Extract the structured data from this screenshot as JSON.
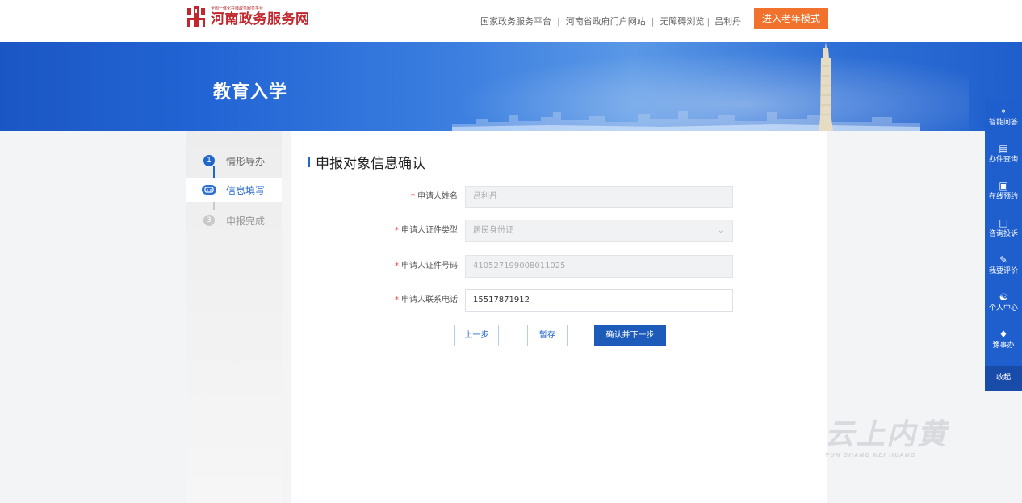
{
  "header": {
    "logo_tagline": "全国一体化在线政务服务平台",
    "logo_title": "河南政务服务网",
    "nav": [
      "国家政务服务平台",
      "河南省政府门户网站",
      "无障碍浏览",
      "吕利丹"
    ],
    "elder_mode": "进入老年模式"
  },
  "banner": {
    "title": "教育入学"
  },
  "steps": [
    {
      "num": "1",
      "label": "情形导办"
    },
    {
      "num": "",
      "label": "信息填写"
    },
    {
      "num": "3",
      "label": "申报完成"
    }
  ],
  "form": {
    "title": "申报对象信息确认",
    "fields": [
      {
        "label": "申请人姓名",
        "value": "吕利丹"
      },
      {
        "label": "申请人证件类型",
        "value": "居民身份证"
      },
      {
        "label": "申请人证件号码",
        "value": "410527199008011025"
      },
      {
        "label": "申请人联系电话",
        "value": "15517871912"
      }
    ],
    "required_mark": "*",
    "buttons": {
      "prev": "上一步",
      "save": "暂存",
      "next": "确认并下一步"
    }
  },
  "sidebar": {
    "items": [
      {
        "icon": "smart-qa-icon",
        "label": "智能问答"
      },
      {
        "icon": "search-doc-icon",
        "label": "办件查询"
      },
      {
        "icon": "calendar-icon",
        "label": "在线预约"
      },
      {
        "icon": "chat-icon",
        "label": "咨询投诉"
      },
      {
        "icon": "edit-icon",
        "label": "我要评价"
      },
      {
        "icon": "user-icon",
        "label": "个人中心"
      },
      {
        "icon": "yushiban-icon",
        "label": "豫事办"
      }
    ],
    "collapse": "收起"
  },
  "watermark": {
    "main": "云上内黄",
    "sub": "YUN SHANG NEI HUANG"
  },
  "colors": {
    "primary": "#2166c9",
    "orange": "#f0722c",
    "brand_red": "#c1272d"
  }
}
